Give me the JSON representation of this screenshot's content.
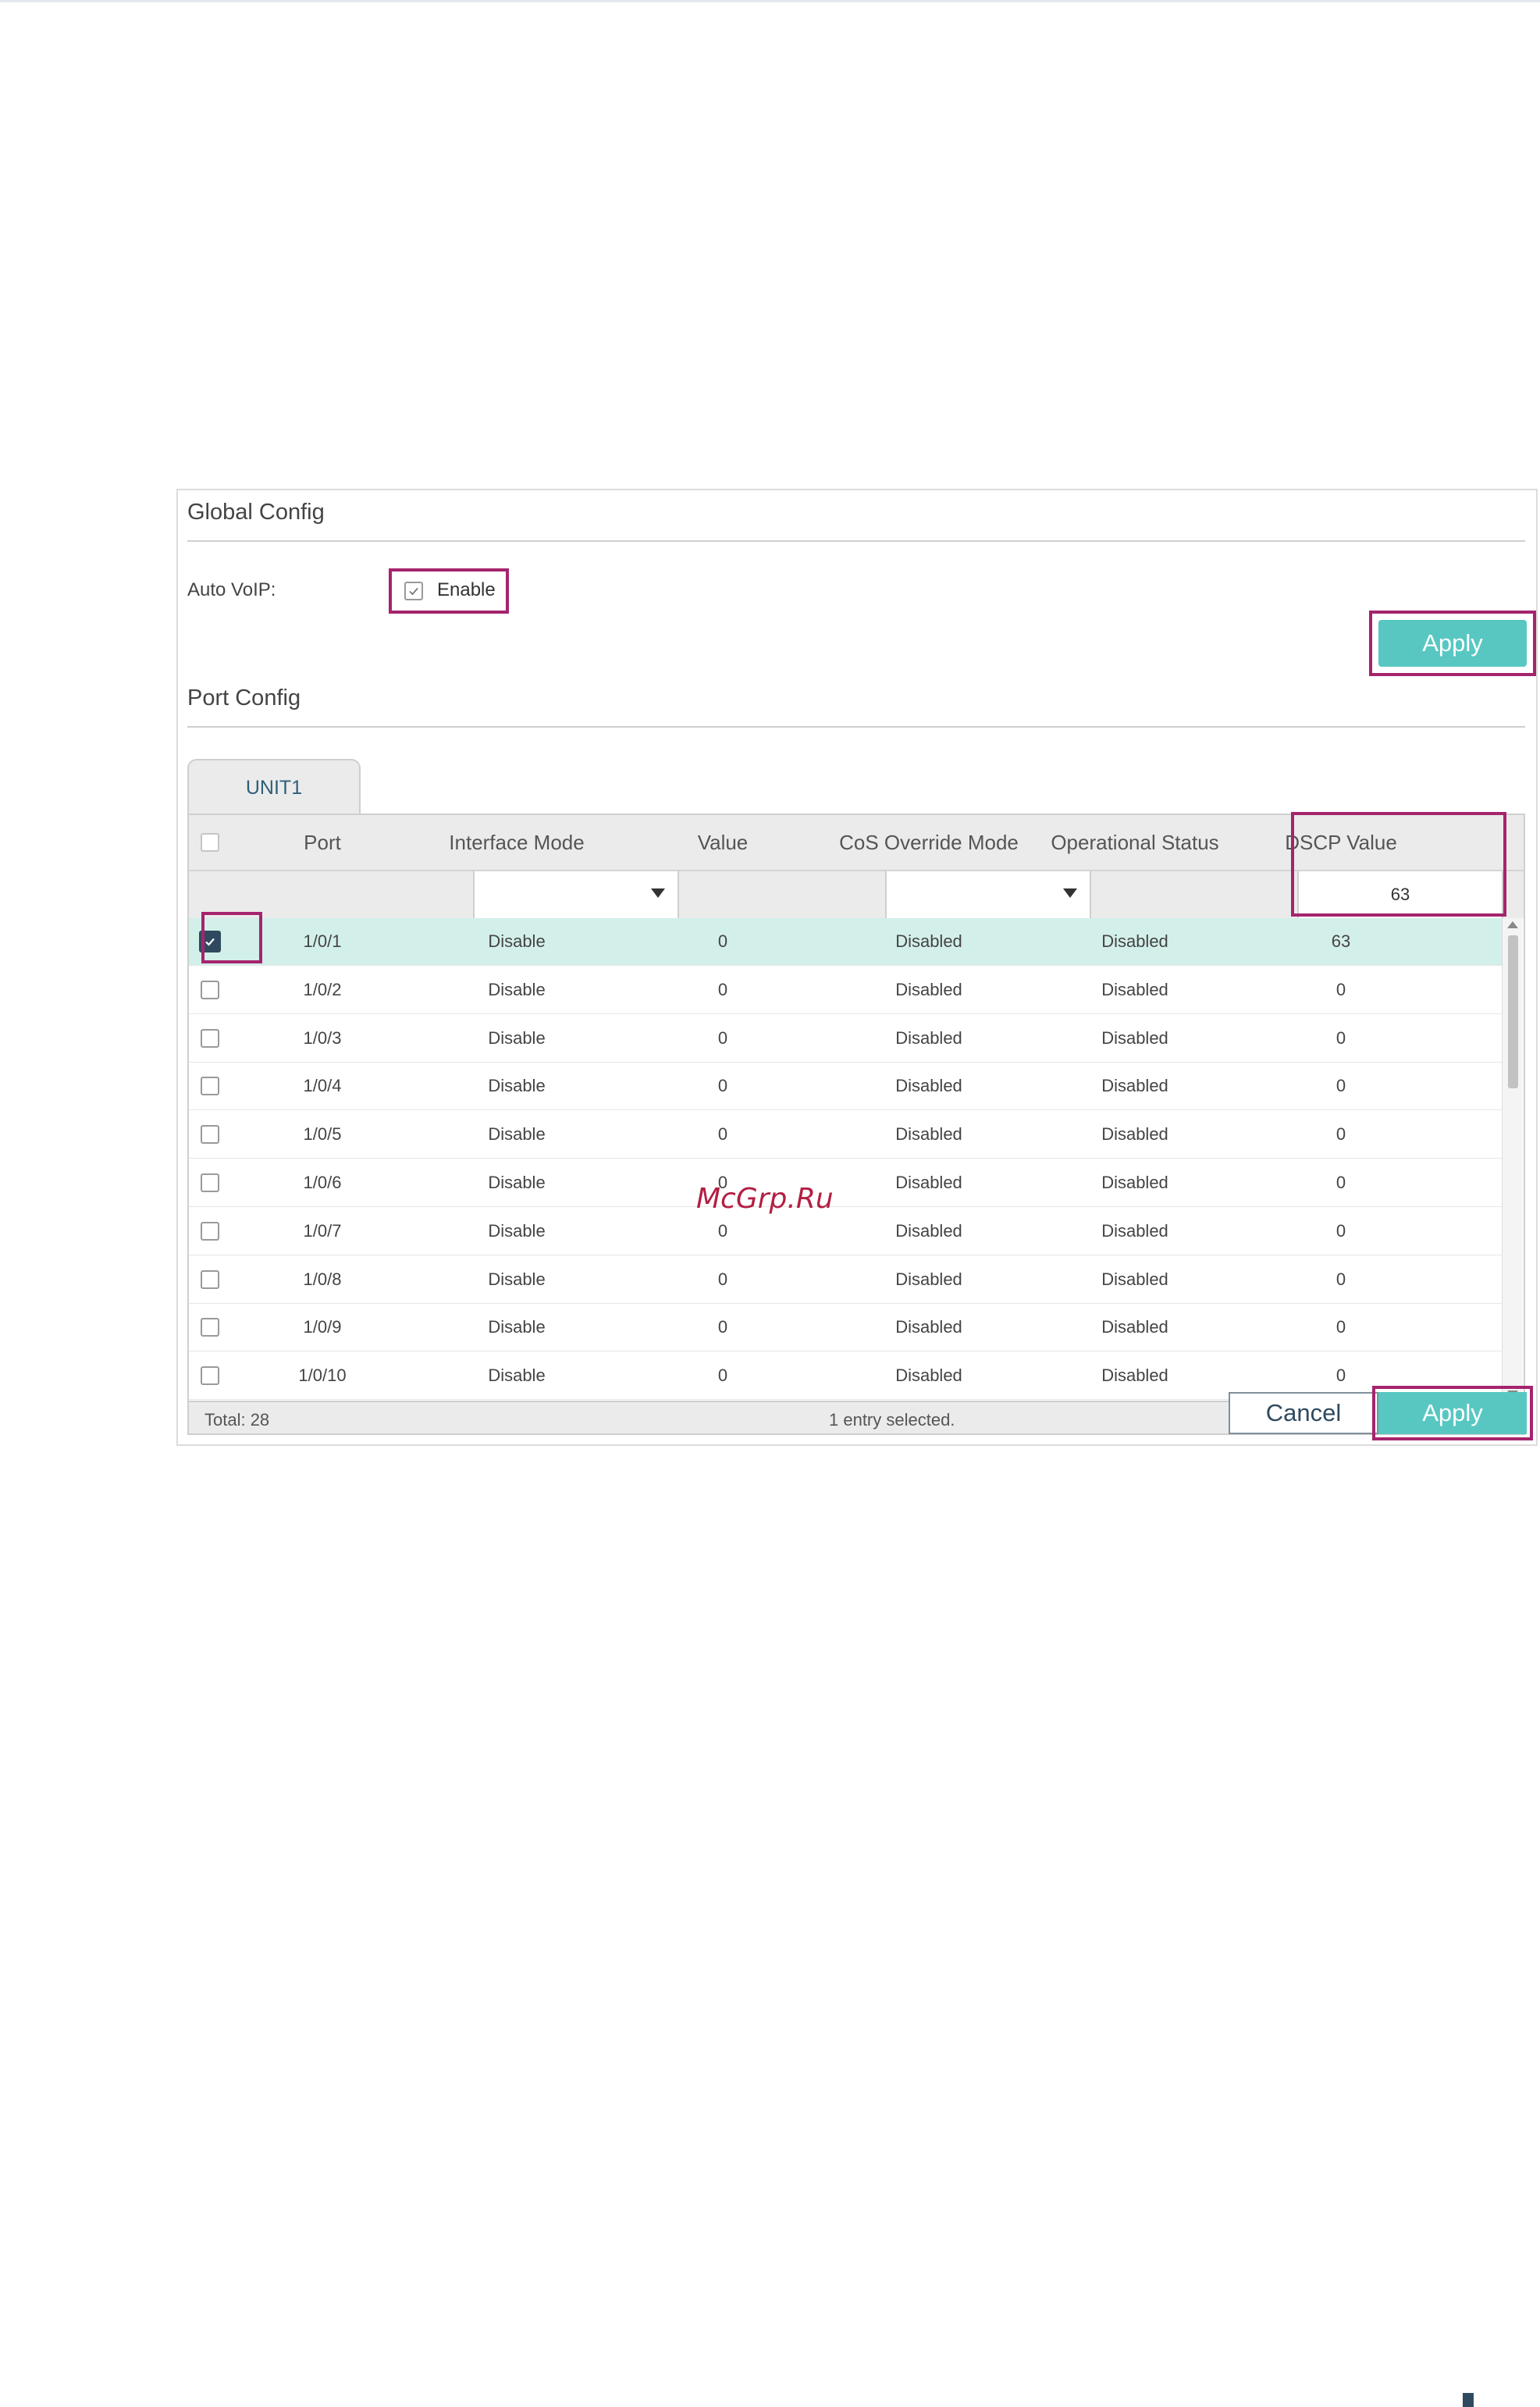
{
  "global_config": {
    "title": "Global Config",
    "auto_voip_label": "Auto VoIP:",
    "enable_label": "Enable",
    "apply_label": "Apply"
  },
  "port_config": {
    "title": "Port Config",
    "tab_label": "UNIT1",
    "columns": [
      "Port",
      "Interface Mode",
      "Value",
      "CoS Override Mode",
      "Operational Status",
      "DSCP Value"
    ],
    "filter_dscp_value": "63",
    "rows": [
      {
        "port": "1/0/1",
        "interface_mode": "Disable",
        "value": "0",
        "cos_override": "Disabled",
        "status": "Disabled",
        "dscp": "63",
        "selected": true
      },
      {
        "port": "1/0/2",
        "interface_mode": "Disable",
        "value": "0",
        "cos_override": "Disabled",
        "status": "Disabled",
        "dscp": "0",
        "selected": false
      },
      {
        "port": "1/0/3",
        "interface_mode": "Disable",
        "value": "0",
        "cos_override": "Disabled",
        "status": "Disabled",
        "dscp": "0",
        "selected": false
      },
      {
        "port": "1/0/4",
        "interface_mode": "Disable",
        "value": "0",
        "cos_override": "Disabled",
        "status": "Disabled",
        "dscp": "0",
        "selected": false
      },
      {
        "port": "1/0/5",
        "interface_mode": "Disable",
        "value": "0",
        "cos_override": "Disabled",
        "status": "Disabled",
        "dscp": "0",
        "selected": false
      },
      {
        "port": "1/0/6",
        "interface_mode": "Disable",
        "value": "0",
        "cos_override": "Disabled",
        "status": "Disabled",
        "dscp": "0",
        "selected": false
      },
      {
        "port": "1/0/7",
        "interface_mode": "Disable",
        "value": "0",
        "cos_override": "Disabled",
        "status": "Disabled",
        "dscp": "0",
        "selected": false
      },
      {
        "port": "1/0/8",
        "interface_mode": "Disable",
        "value": "0",
        "cos_override": "Disabled",
        "status": "Disabled",
        "dscp": "0",
        "selected": false
      },
      {
        "port": "1/0/9",
        "interface_mode": "Disable",
        "value": "0",
        "cos_override": "Disabled",
        "status": "Disabled",
        "dscp": "0",
        "selected": false
      },
      {
        "port": "1/0/10",
        "interface_mode": "Disable",
        "value": "0",
        "cos_override": "Disabled",
        "status": "Disabled",
        "dscp": "0",
        "selected": false
      }
    ],
    "footer": {
      "total": "Total: 28",
      "selection": "1 entry selected.",
      "cancel_label": "Cancel",
      "apply_label": "Apply"
    }
  },
  "watermark": "McGrp.Ru",
  "colors": {
    "accent": "#58c7c1",
    "highlight": "#a5246d",
    "selected_row": "#d3efea",
    "checkbox_checked": "#2f4a5f"
  }
}
